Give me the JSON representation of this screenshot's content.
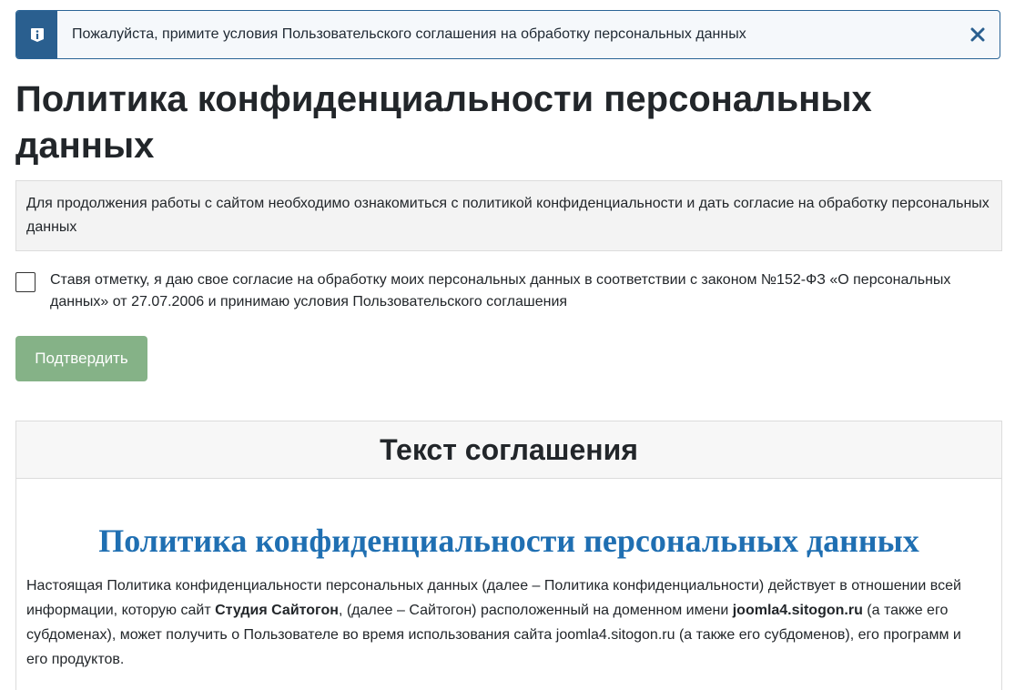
{
  "alert": {
    "icon": "info-icon",
    "message": "Пожалуйста, примите условия Пользовательского соглашения на обработку персональных данных",
    "close_icon": "close-icon"
  },
  "page": {
    "title": "Политика конфиденциальности персональных данных"
  },
  "info_box": {
    "text": "Для продолжения работы с сайтом необходимо ознакомиться с политикой конфиденциальности и дать согласие на обработку персональных данных"
  },
  "consent": {
    "checked": false,
    "label": "Ставя отметку, я даю свое согласие на обработку моих персональных данных в соответствии с законом №152-ФЗ «О персональных данных» от 27.07.2006 и принимаю условия Пользовательского соглашения"
  },
  "confirm_button": {
    "label": "Подтвердить"
  },
  "agreement": {
    "header": "Текст соглашения",
    "doc_title": "Политика конфиденциальности персональных данных",
    "paragraph": {
      "part1": "Настоящая Политика конфиденциальности персональных данных (далее – Политика конфиденциальности) действует в отношении всей информации, которую сайт ",
      "studio": "Студия Сайтогон",
      "part2": ", (далее – Сайтогон) расположенный на доменном имени ",
      "domain": "joomla4.sitogon.ru",
      "part3": " (а также его субдоменах), может получить о Пользователе во время использования сайта joomla4.sitogon.ru (а также его субдоменов), его программ и его продуктов."
    }
  },
  "colors": {
    "alert_border": "#2a6496",
    "alert_icon_bg": "#2a5f8f",
    "button_bg": "#85b287",
    "doc_title": "#1f6fb2"
  }
}
